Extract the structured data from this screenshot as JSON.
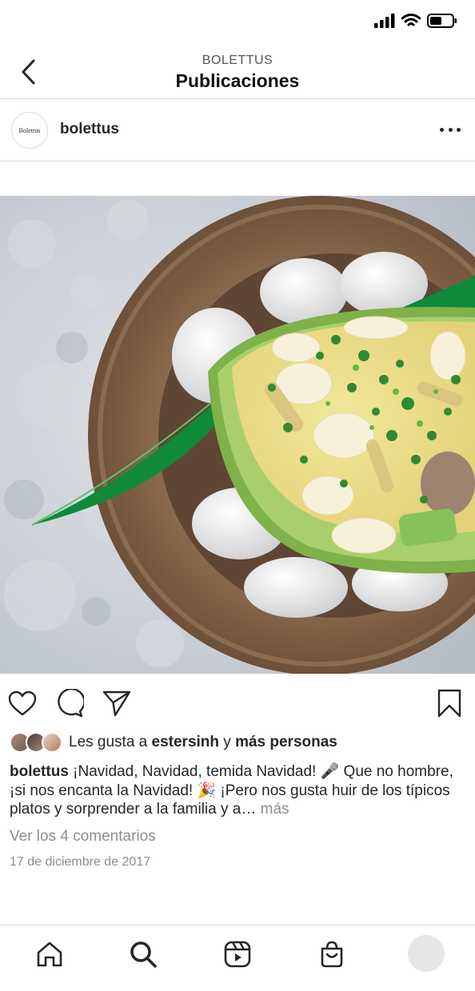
{
  "header": {
    "account_name": "BOLETTUS",
    "title": "Publicaciones"
  },
  "post": {
    "avatar_text": "Bolettus",
    "username": "bolettus",
    "image_icon": "food-photo",
    "likes": {
      "prefix": "Les gusta a",
      "user": "estersinh",
      "connector": "y",
      "others": "más personas"
    },
    "caption": {
      "username": "bolettus",
      "text": "¡Navidad, Navidad, temida Navidad! 🎤 Que no hombre, ¡si nos encanta la Navidad! 🎉 ¡Pero nos gusta huir de los típicos platos y sorprender a la familia y a…",
      "more": "más"
    },
    "comments_link": "Ver los 4 comentarios",
    "date": "17 de diciembre de 2017"
  },
  "icons": {
    "status": [
      "signal-icon",
      "wifi-icon",
      "battery-icon"
    ],
    "actions": [
      "heart-icon",
      "comment-icon",
      "share-icon",
      "bookmark-icon"
    ],
    "bottom_nav": [
      "home-icon",
      "search-icon",
      "reels-icon",
      "shop-icon",
      "profile-avatar"
    ]
  },
  "colors": {
    "text": "#262626",
    "secondary": "#8e8e8e",
    "divider": "#dbdbdb"
  }
}
